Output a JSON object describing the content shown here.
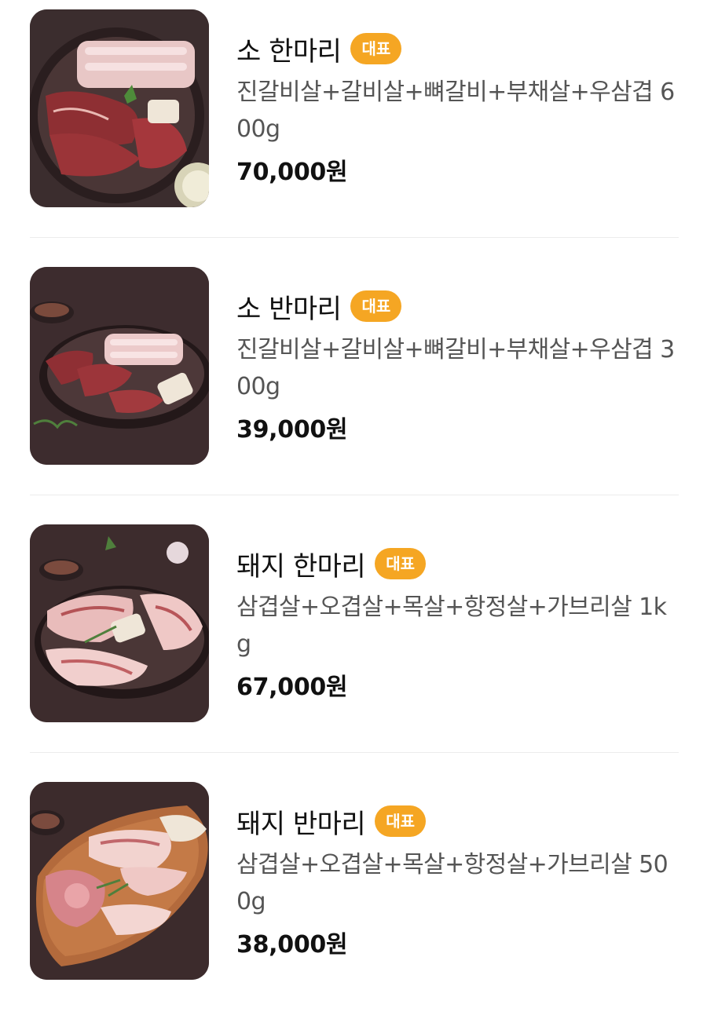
{
  "menu": {
    "badge_label": "대표",
    "items": [
      {
        "name": "소 한마리",
        "description": "진갈비살+갈비살+뼈갈비+부채살+우삼겹 600g",
        "price": "70,000원",
        "image": "beef-platter-round-dark-plate"
      },
      {
        "name": "소 반마리",
        "description": "진갈비살+갈비살+뼈갈비+부채살+우삼겹 300g",
        "price": "39,000원",
        "image": "beef-half-platter-plate"
      },
      {
        "name": "돼지 한마리",
        "description": "삼겹살+오겹살+목살+항정살+가브리살 1kg",
        "price": "67,000원",
        "image": "pork-platter-dark-plate"
      },
      {
        "name": "돼지 반마리",
        "description": "삼겹살+오겹살+목살+항정살+가브리살 500g",
        "price": "38,000원",
        "image": "pork-platter-wooden-board"
      }
    ]
  },
  "colors": {
    "badge": "#f5a623",
    "text": "#111111",
    "desc": "#555555",
    "divider": "#ececec",
    "photo_bg": "#3a2b2c"
  }
}
